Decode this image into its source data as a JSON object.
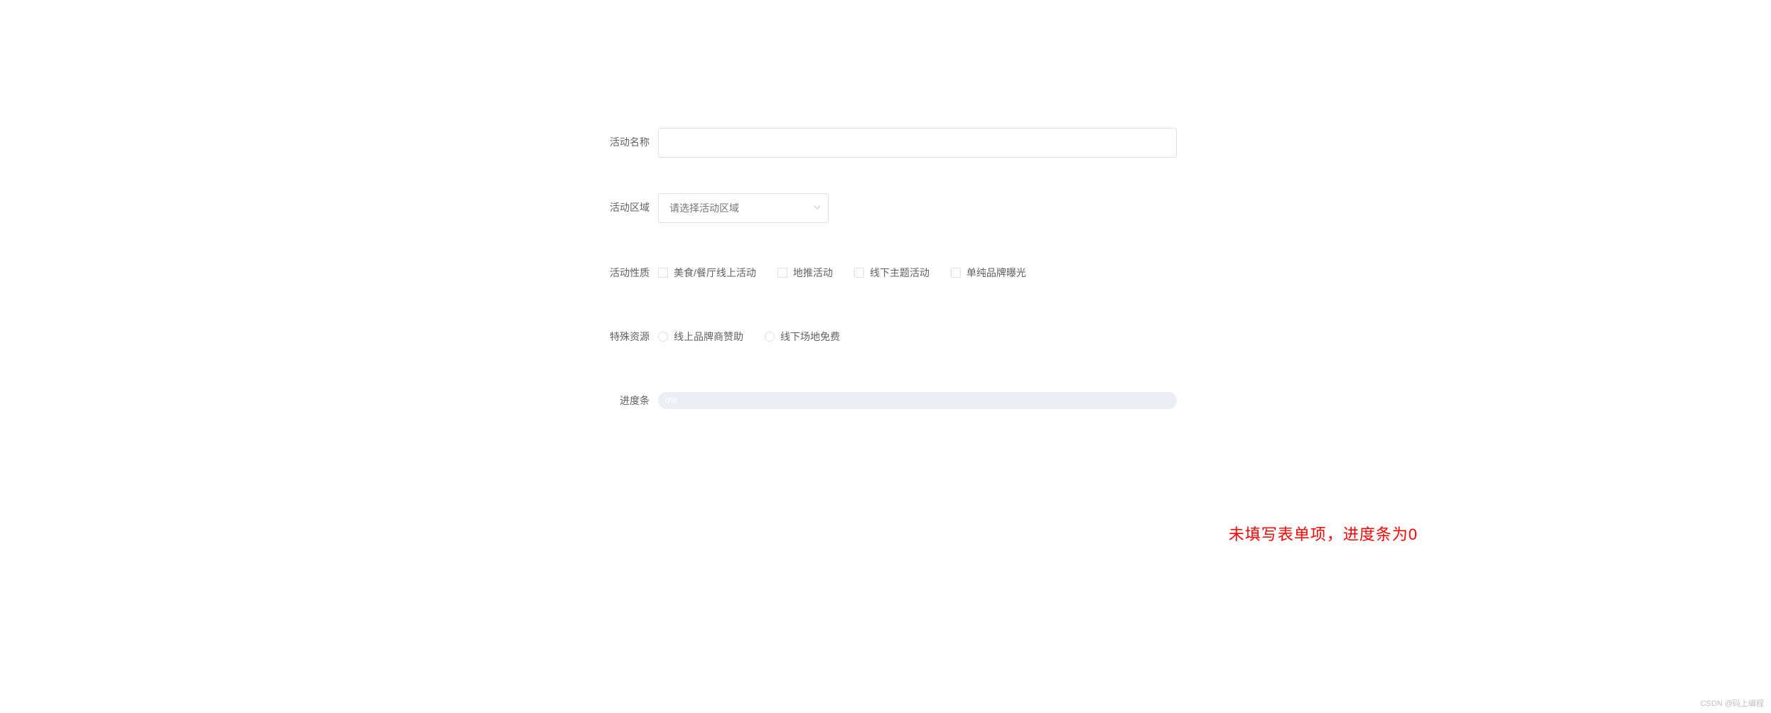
{
  "form": {
    "activity_name": {
      "label": "活动名称",
      "value": ""
    },
    "activity_region": {
      "label": "活动区域",
      "placeholder": "请选择活动区域"
    },
    "activity_type": {
      "label": "活动性质",
      "options": [
        "美食/餐厅线上活动",
        "地推活动",
        "线下主题活动",
        "单纯品牌曝光"
      ]
    },
    "special_resource": {
      "label": "特殊资源",
      "options": [
        "线上品牌商赞助",
        "线下场地免费"
      ]
    },
    "progress": {
      "label": "进度条",
      "percentage": "0%"
    }
  },
  "annotation": "未填写表单项，进度条为0",
  "watermark": "CSDN @码上编程"
}
